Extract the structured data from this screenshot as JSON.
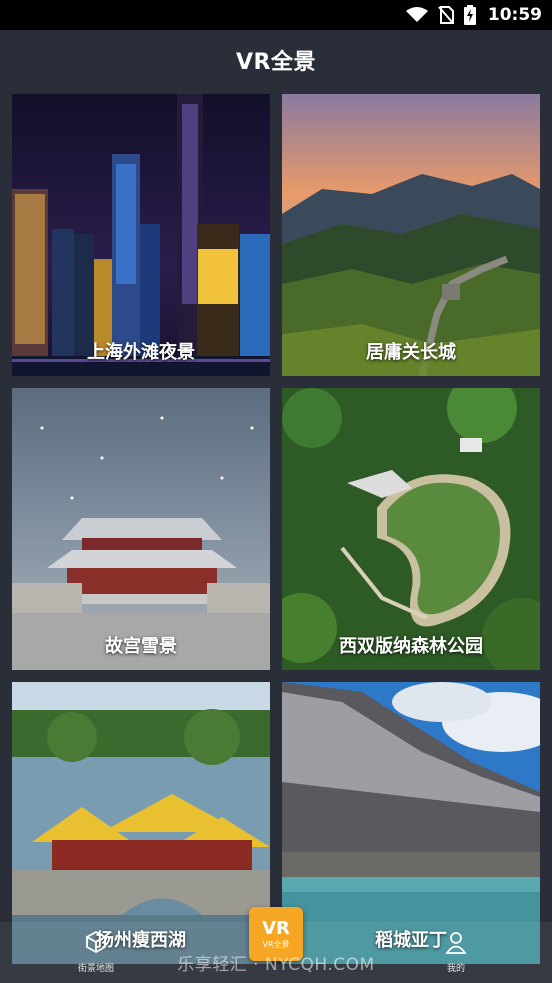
{
  "status_bar": {
    "time": "10:59",
    "icons": [
      "wifi-icon",
      "no-sim-icon",
      "battery-charging-icon"
    ]
  },
  "header": {
    "title": "VR全景"
  },
  "cards": [
    {
      "label": "上海外滩夜景"
    },
    {
      "label": "居庸关长城"
    },
    {
      "label": "故宫雪景"
    },
    {
      "label": "西双版纳森林公园"
    },
    {
      "label": "扬州瘦西湖"
    },
    {
      "label": "稻城亚丁"
    }
  ],
  "bottom_nav": {
    "left": {
      "label": "街景地图",
      "icon": "map-cube-icon"
    },
    "center": {
      "text": "VR",
      "label": "VR全景",
      "icon": "vr-icon"
    },
    "right": {
      "label": "我的",
      "icon": "user-icon"
    }
  },
  "watermark": "乐享轻汇 · NYCQH.COM",
  "colors": {
    "background": "#2a2e38",
    "accent": "#f5a623",
    "status_bar": "#000000"
  }
}
